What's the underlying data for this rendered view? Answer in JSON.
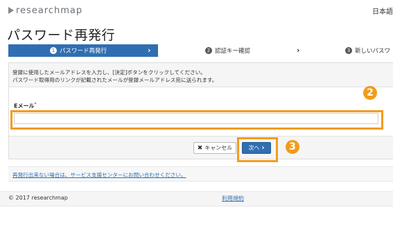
{
  "header": {
    "logo_text": "researchmap",
    "language": "日本語"
  },
  "page": {
    "title": "パスワード再発行"
  },
  "stepper": {
    "steps": [
      {
        "number": "1",
        "label": "パスワード再発行"
      },
      {
        "number": "2",
        "label": "認証キー確認"
      },
      {
        "number": "3",
        "label": "新しいパスワ"
      }
    ]
  },
  "form": {
    "info_line1": "登録に使用したメールアドレスを入力し、[決定]ボタンをクリックしてください。",
    "info_line2": "パスワード取得用のリンクが記載されたメールが登録メールアドレス宛に送られます。",
    "email_label": "Eメール",
    "required_mark": "*",
    "email_value": "",
    "cancel_label": "キャンセル",
    "next_label": "次へ"
  },
  "annotations": {
    "badge_email": "2",
    "badge_next": "3"
  },
  "help": {
    "link_text": "再発行出来ない場合は、サービス支援センターにお問い合わせください。"
  },
  "footer": {
    "copyright": "2017 researchmap",
    "terms": "利用規約"
  },
  "colors": {
    "primary": "#2f6fb1",
    "highlight": "#f29c1b"
  }
}
